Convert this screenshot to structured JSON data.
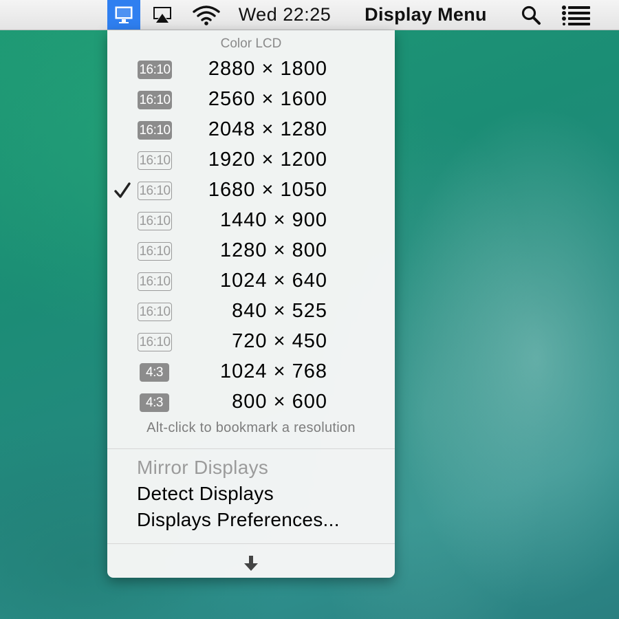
{
  "menubar": {
    "clock": "Wed 22:25",
    "app_name": "Display Menu",
    "icons": {
      "display": "display-icon",
      "airplay": "airplay-icon",
      "wifi": "wifi-icon",
      "search": "spotlight-search-icon",
      "list": "notification-center-icon"
    },
    "active_color": "#2f7ff0"
  },
  "menu": {
    "header": "Color LCD",
    "resolutions": [
      {
        "aspect": "16:10",
        "label": "2880 × 1800",
        "highlighted": true,
        "checked": false
      },
      {
        "aspect": "16:10",
        "label": "2560 × 1600",
        "highlighted": true,
        "checked": false
      },
      {
        "aspect": "16:10",
        "label": "2048 × 1280",
        "highlighted": true,
        "checked": false
      },
      {
        "aspect": "16:10",
        "label": "1920 × 1200",
        "highlighted": false,
        "checked": false
      },
      {
        "aspect": "16:10",
        "label": "1680 × 1050",
        "highlighted": false,
        "checked": true
      },
      {
        "aspect": "16:10",
        "label": "1440 × 900",
        "highlighted": false,
        "checked": false
      },
      {
        "aspect": "16:10",
        "label": "1280 × 800",
        "highlighted": false,
        "checked": false
      },
      {
        "aspect": "16:10",
        "label": "1024 × 640",
        "highlighted": false,
        "checked": false
      },
      {
        "aspect": "16:10",
        "label": "840 × 525",
        "highlighted": false,
        "checked": false
      },
      {
        "aspect": "16:10",
        "label": "720 × 450",
        "highlighted": false,
        "checked": false
      },
      {
        "aspect": "4:3",
        "label": "1024 × 768",
        "highlighted": true,
        "checked": false
      },
      {
        "aspect": "4:3",
        "label": "800 × 600",
        "highlighted": true,
        "checked": false
      }
    ],
    "hint": "Alt-click to bookmark a resolution",
    "actions": {
      "mirror": "Mirror Displays",
      "detect": "Detect Displays",
      "preferences": "Displays Preferences..."
    },
    "more_icon": "down-arrow-icon"
  }
}
